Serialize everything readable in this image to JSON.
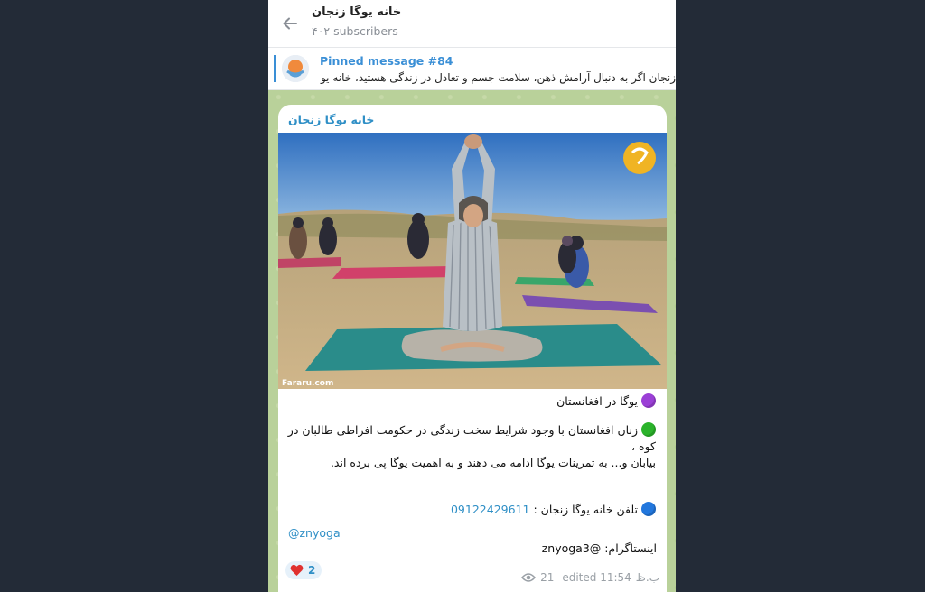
{
  "header": {
    "title": "خانه یوگا زنجان",
    "subscribers": "۴۰۲ subscribers"
  },
  "pinned": {
    "label": "Pinned message #84",
    "text": "زنجان اگر به دنبال آرامش ذهن، سلامت جسم و تعادل در زندگی هستید، خانه یو..."
  },
  "message": {
    "sender": "خانه یوگا زنجان",
    "watermark_text": "Fararu.com",
    "headline": "یوگا در افغانستان",
    "body_line1": "زنان افغانستان با وجود شرایط سخت زندگی در حکومت افراطی طالبان در کوه ،",
    "body_line2": "بیابان و... به تمرینات یوگا ادامه می دهند و به اهمیت یوگا  پی برده اند.",
    "phone_label": "تلفن خانه یوگا زنجان  :",
    "phone_number": "09122429611",
    "handle": "@znyoga",
    "instagram": "اینستاگرام: @znyoga3",
    "reaction_count": "2",
    "views": "21",
    "edited_time": "edited 11:54",
    "day_suffix": "ب.ظ"
  },
  "colors": {
    "accent": "#3a8fd6",
    "sender": "#2f8fc6",
    "chat_bg": "#b9d19a",
    "window_bg": "#232b37"
  }
}
